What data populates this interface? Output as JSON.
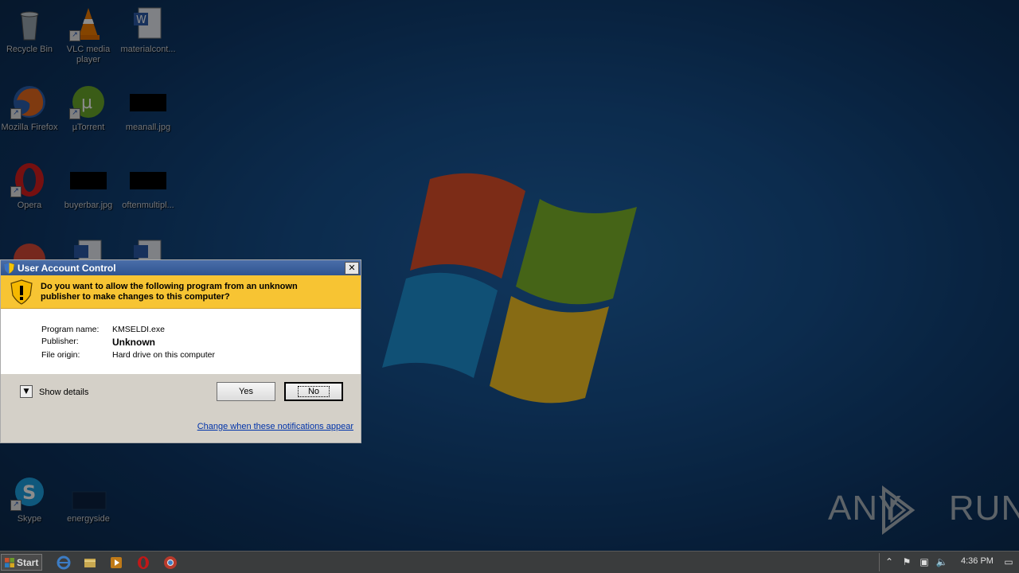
{
  "desktop": {
    "icons": [
      {
        "label": "Recycle Bin"
      },
      {
        "label": "VLC media player"
      },
      {
        "label": "materialcont..."
      },
      {
        "label": "Mozilla Firefox"
      },
      {
        "label": "µTorrent"
      },
      {
        "label": "meanall.jpg"
      },
      {
        "label": "Opera"
      },
      {
        "label": "buyerbar.jpg"
      },
      {
        "label": "oftenmultipl..."
      },
      {
        "label": "Skype"
      },
      {
        "label": "energyside"
      }
    ]
  },
  "uac": {
    "title": "User Account Control",
    "close_label": "✕",
    "question": "Do you want to allow the following program from an unknown publisher to make changes to this computer?",
    "fields": [
      {
        "key": "Program name:",
        "value": "KMSELDI.exe"
      },
      {
        "key": "Publisher:",
        "value": "Unknown"
      },
      {
        "key": "File origin:",
        "value": "Hard drive on this computer"
      }
    ],
    "show_details_label": "Show details",
    "yes_label": "Yes",
    "no_label": "No",
    "change_link": "Change when these notifications appear"
  },
  "taskbar": {
    "start_label": "Start",
    "clock": "4:36 PM"
  },
  "watermark": {
    "text": "ANY RUN"
  },
  "colors": {
    "uac_header": "#f7c433",
    "title_bar": "#2f5490",
    "link": "#0033aa"
  }
}
